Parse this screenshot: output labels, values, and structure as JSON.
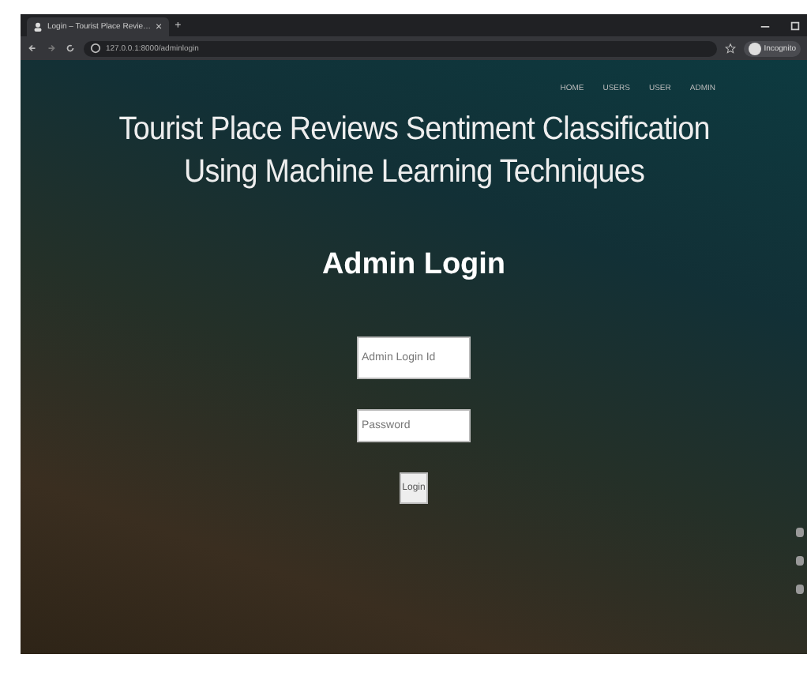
{
  "browser": {
    "tab_title": "Login – Tourist Place Revie…",
    "tab_close": "×",
    "new_tab": "+",
    "address": "127.0.0.1:8000/adminlogin",
    "profile": "Incognito"
  },
  "nav": [
    "HOME",
    "USERS",
    "USER",
    "ADMIN"
  ],
  "title": [
    "Tourist Place Reviews Sentiment Classification",
    "Using Machine Learning Techniques"
  ],
  "heading": "Admin Login",
  "form": {
    "fields": [
      {
        "kind": "text",
        "placeholder": "Admin Login Id"
      },
      {
        "kind": "password",
        "placeholder": "Password"
      }
    ],
    "button": "Login"
  }
}
